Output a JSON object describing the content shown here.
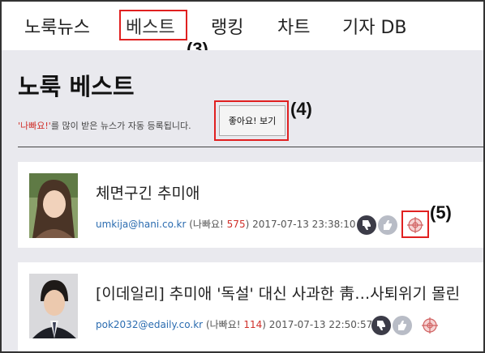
{
  "nav": {
    "items": [
      {
        "label": "노룩뉴스"
      },
      {
        "label": "베스트"
      },
      {
        "label": "랭킹"
      },
      {
        "label": "차트"
      },
      {
        "label": "기자 DB"
      }
    ]
  },
  "annotations": [
    "(3)",
    "(4)",
    "(5)"
  ],
  "page": {
    "title": "노룩 베스트",
    "notice_highlight": "'나빠요!'",
    "notice_rest": "를 많이 받은 뉴스가 자동 등록됩니다.",
    "like_button": "좋아요! 보기"
  },
  "articles": [
    {
      "headline": "체면구긴 추미애",
      "email": "umkija@hani.co.kr",
      "bad_prefix": "(나빠요! ",
      "bad_count": "575",
      "bad_suffix": ")",
      "datetime": "2017-07-13 23:38:10"
    },
    {
      "headline": "[이데일리] 추미애 '독설' 대신 사과한 靑…사퇴위기 몰린",
      "email": "pok2032@edaily.co.kr",
      "bad_prefix": "(나빠요! ",
      "bad_count": "114",
      "bad_suffix": ")",
      "datetime": "2017-07-13 22:50:57"
    }
  ],
  "icons": [
    "thumbs-down-icon",
    "thumbs-up-icon",
    "target-icon"
  ],
  "colors": {
    "accent_red": "#d0302a",
    "link_blue": "#2b6cb0",
    "annotation_box": "#e02020"
  }
}
